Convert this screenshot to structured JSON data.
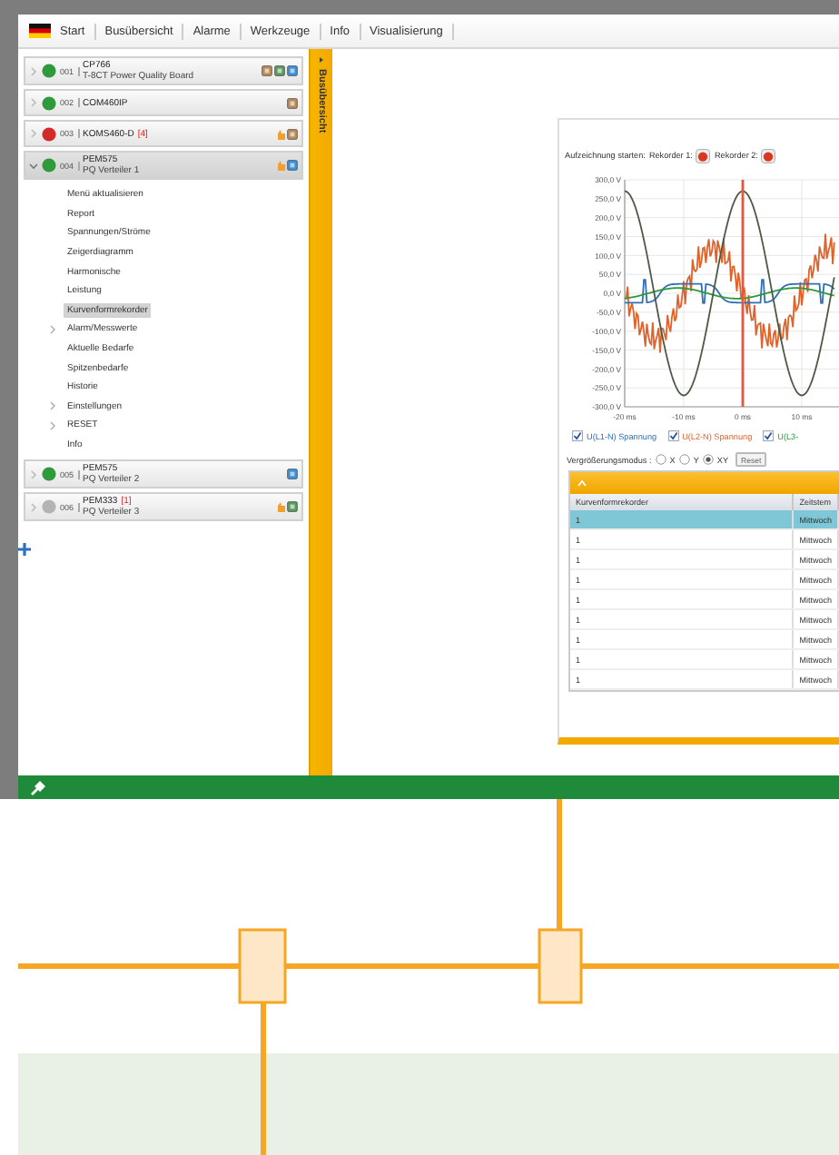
{
  "menu_bar": {
    "items": [
      "Start",
      "Busübersicht",
      "Alarme",
      "Werkzeuge",
      "Info",
      "Visualisierung"
    ]
  },
  "device_tree": {
    "devices": [
      {
        "number": "001",
        "name": "CP766",
        "subtitle": "T-8CT Power Quality Board",
        "color": "#2e9a3a",
        "expanded": false,
        "selected": false,
        "badges": [
          {
            "kind": "alarm"
          },
          {
            "kind": "ok"
          },
          {
            "kind": "info"
          }
        ]
      },
      {
        "number": "002",
        "name": "COM460IP",
        "color": "#2e9a3a",
        "expanded": false,
        "selected": false,
        "badges": [
          {
            "kind": "alarm"
          }
        ]
      },
      {
        "number": "003",
        "name": "KOMS460-D",
        "alarm": "[4]",
        "color": "#d42a2a",
        "expanded": false,
        "selected": false,
        "badges": [
          {
            "kind": "hand"
          },
          {
            "kind": "alarm"
          }
        ]
      },
      {
        "number": "004",
        "name": "PEM575",
        "subtitle": "PQ Verteiler 1",
        "color": "#2e9a3a",
        "expanded": true,
        "selected": true,
        "badges": [
          {
            "kind": "hand"
          },
          {
            "kind": "info"
          }
        ],
        "menu": [
          {
            "label": "Menü aktualisieren",
            "selected": false,
            "has_children": false
          },
          {
            "label": "Report",
            "selected": false,
            "has_children": false
          },
          {
            "label": "Spannungen/Ströme",
            "selected": false,
            "has_children": false
          },
          {
            "label": "Zeigerdiagramm",
            "selected": false,
            "has_children": false
          },
          {
            "label": "Harmonische",
            "selected": false,
            "has_children": false
          },
          {
            "label": "Leistung",
            "selected": false,
            "has_children": false
          },
          {
            "label": "Kurvenformrekorder",
            "selected": true,
            "has_children": false
          },
          {
            "label": "Alarm/Messwerte",
            "selected": false,
            "has_children": true
          },
          {
            "label": "Aktuelle Bedarfe",
            "selected": false,
            "has_children": false
          },
          {
            "label": "Spitzenbedarfe",
            "selected": false,
            "has_children": false
          },
          {
            "label": "Historie",
            "selected": false,
            "has_children": false
          },
          {
            "label": "Einstellungen",
            "selected": false,
            "has_children": true
          },
          {
            "label": "RESET",
            "selected": false,
            "has_children": true
          },
          {
            "label": "Info",
            "selected": false,
            "has_children": false
          }
        ]
      },
      {
        "number": "005",
        "name": "PEM575",
        "subtitle": "PQ Verteiler 2",
        "color": "#2e9a3a",
        "expanded": false,
        "selected": false,
        "badges": [
          {
            "kind": "info"
          }
        ]
      },
      {
        "number": "006",
        "name": "PEM333",
        "alarm": "[1]",
        "subtitle": "PQ Verteiler 3",
        "color": "#b4b4b4",
        "expanded": false,
        "selected": false,
        "badges": [
          {
            "kind": "hand"
          },
          {
            "kind": "ok"
          }
        ]
      }
    ]
  },
  "side_strip": {
    "title": "Busübersicht"
  },
  "recorder": {
    "label": "Aufzeichnung starten:",
    "recorders": [
      "Rekorder 1:",
      "Rekorder 2:"
    ]
  },
  "chart": {
    "y_ticks": [
      "300,0 V",
      "250,0 V",
      "200,0 V",
      "150,0 V",
      "100,0 V",
      "50,0 V",
      "0,0 V",
      "-50,0 V",
      "-100,0 V",
      "-150,0 V",
      "-200,0 V",
      "-250,0 V",
      "-300,0 V"
    ],
    "x_ticks": [
      "-20 ms",
      "-10 ms",
      "0 ms",
      "10 ms"
    ]
  },
  "legend": [
    {
      "label": "U(L1-N) Spannung",
      "checked": true
    },
    {
      "label": "U(L2-N) Spannung",
      "checked": true
    },
    {
      "label": "U(L3-",
      "checked": true
    }
  ],
  "zoom_mode": {
    "label": "Vergrößerungsmodus :",
    "options": [
      {
        "label": "X",
        "selected": false
      },
      {
        "label": "Y",
        "selected": false
      },
      {
        "label": "XY",
        "selected": true
      }
    ],
    "reset": "Reset"
  },
  "table": {
    "columns": [
      "Kurvenformrekorder",
      "Zeitstem"
    ],
    "rows": [
      {
        "cells": [
          "1",
          "Mittwoch"
        ],
        "selected": true
      },
      {
        "cells": [
          "1",
          "Mittwoch"
        ],
        "selected": false
      },
      {
        "cells": [
          "1",
          "Mittwoch"
        ],
        "selected": false
      },
      {
        "cells": [
          "1",
          "Mittwoch"
        ],
        "selected": false
      },
      {
        "cells": [
          "1",
          "Mittwoch"
        ],
        "selected": false
      },
      {
        "cells": [
          "1",
          "Mittwoch"
        ],
        "selected": false
      },
      {
        "cells": [
          "1",
          "Mittwoch"
        ],
        "selected": false
      },
      {
        "cells": [
          "1",
          "Mittwoch"
        ],
        "selected": false
      },
      {
        "cells": [
          "1",
          "Mittwoch"
        ],
        "selected": false
      }
    ]
  }
}
